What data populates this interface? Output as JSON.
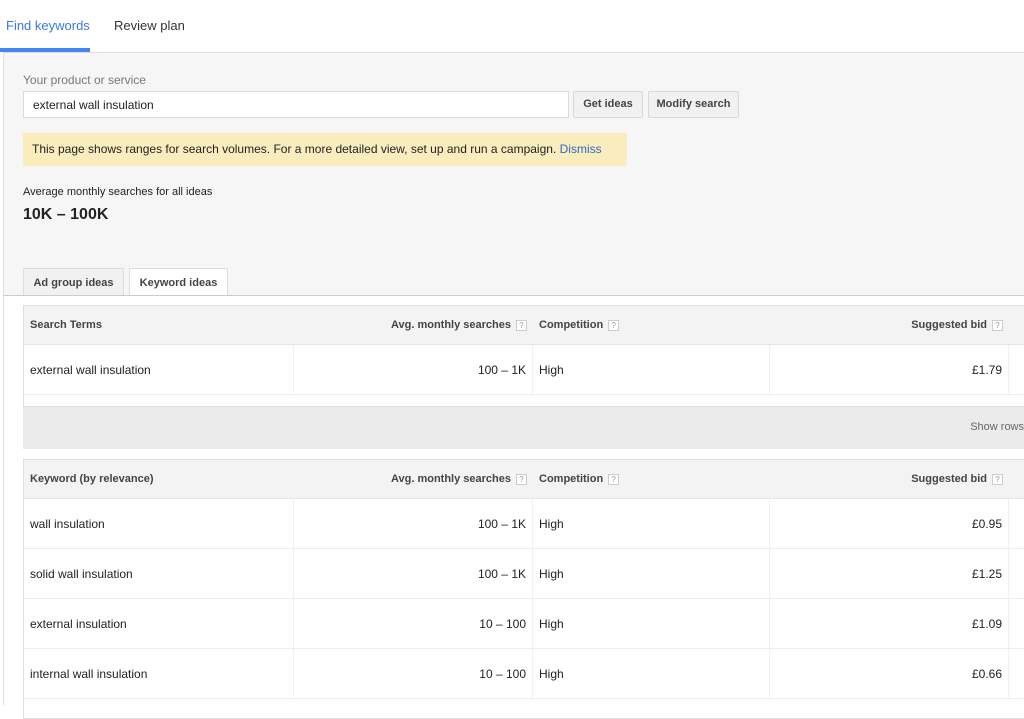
{
  "tabs": {
    "find_keywords": "Find keywords",
    "review_plan": "Review plan"
  },
  "accent_color": "#4285f4",
  "search": {
    "label": "Your product or service",
    "value": "external wall insulation",
    "get_ideas": "Get ideas",
    "modify_search": "Modify search"
  },
  "notice": {
    "text": "This page shows ranges for search volumes. For a more detailed view, set up and run a campaign.",
    "dismiss": "Dismiss"
  },
  "summary": {
    "label": "Average monthly searches for all ideas",
    "value": "10K – 100K"
  },
  "subtabs": {
    "ad_group_ideas": "Ad group ideas",
    "keyword_ideas": "Keyword ideas"
  },
  "help_glyph": "?",
  "search_terms": {
    "headers": [
      "Search Terms",
      "Avg. monthly searches",
      "Competition",
      "Suggested bid"
    ],
    "rows": [
      [
        "external wall insulation",
        "100 – 1K",
        "High",
        "£1.79"
      ]
    ]
  },
  "show_rows": "Show rows",
  "keyword_ideas": {
    "headers": [
      "Keyword (by relevance)",
      "Avg. monthly searches",
      "Competition",
      "Suggested bid"
    ],
    "rows": [
      [
        "wall insulation",
        "100 – 1K",
        "High",
        "£0.95"
      ],
      [
        "solid wall insulation",
        "100 – 1K",
        "High",
        "£1.25"
      ],
      [
        "external insulation",
        "10 – 100",
        "High",
        "£1.09"
      ],
      [
        "internal wall insulation",
        "10 – 100",
        "High",
        "£0.66"
      ]
    ]
  }
}
